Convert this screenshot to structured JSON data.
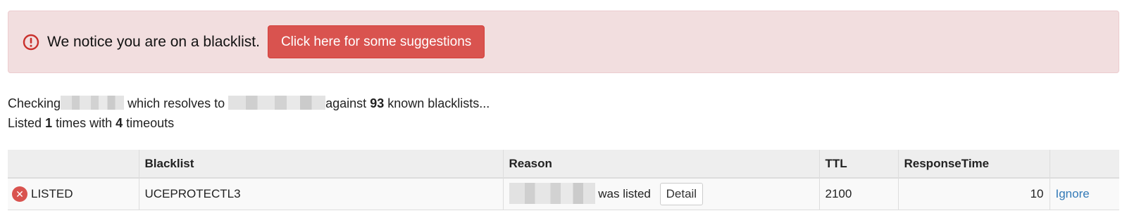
{
  "alert": {
    "icon": "exclamation-circle-icon",
    "message": "We notice you are on a blacklist.",
    "button_label": "Click here for some suggestions",
    "color": "#d9534f"
  },
  "summary": {
    "checking_label": "Checking",
    "resolves_label": "which resolves to",
    "against_label": "against",
    "known_count": "93",
    "known_label": "known blacklists...",
    "listed_label": "Listed",
    "listed_count": "1",
    "times_label": "times with",
    "timeouts_count": "4",
    "timeouts_label": "timeouts"
  },
  "table": {
    "headers": [
      "",
      "Blacklist",
      "Reason",
      "TTL",
      "ResponseTime",
      ""
    ],
    "rows": [
      {
        "status_icon": "x-circle-icon",
        "status": "LISTED",
        "blacklist": "UCEPROTECTL3",
        "reason_suffix": "was listed",
        "detail_label": "Detail",
        "ttl": "2100",
        "response_time": "10",
        "action_label": "Ignore"
      }
    ]
  }
}
